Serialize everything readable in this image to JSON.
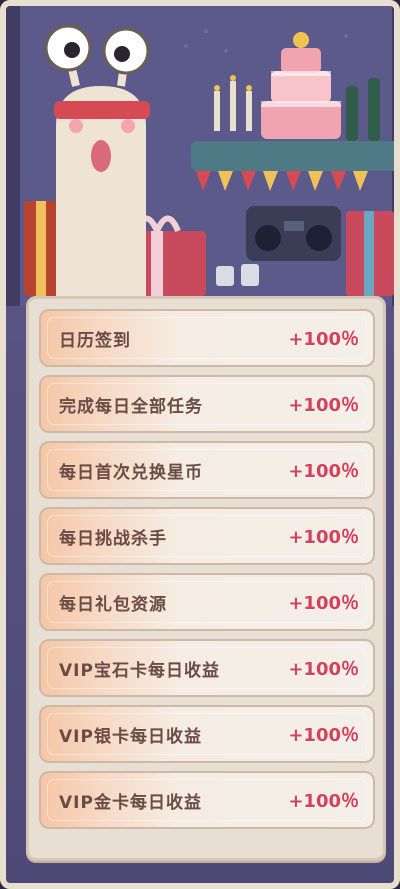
{
  "bonus_list": [
    {
      "label": "日历签到",
      "value": "+100％"
    },
    {
      "label": "完成每日全部任务",
      "value": "+100％"
    },
    {
      "label": "每日首次兑换星币",
      "value": "+100％"
    },
    {
      "label": "每日挑战杀手",
      "value": "+100％"
    },
    {
      "label": "每日礼包资源",
      "value": "+100％"
    },
    {
      "label": "VIP宝石卡每日收益",
      "value": "+100％"
    },
    {
      "label": "VIP银卡每日收益",
      "value": "+100％"
    },
    {
      "label": "VIP金卡每日收益",
      "value": "+100％"
    }
  ],
  "colors": {
    "accent": "#d4415b",
    "label": "#6a4b45",
    "panel": "#e8dfd4"
  }
}
